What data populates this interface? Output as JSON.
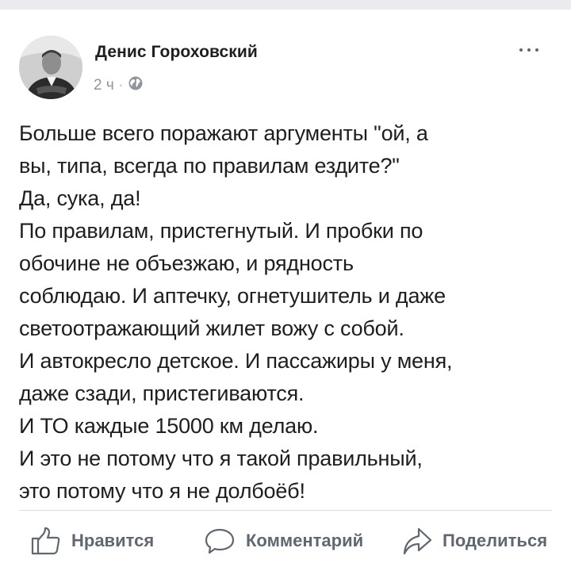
{
  "post": {
    "author_name": "Денис Гороховский",
    "time_ago": "2 ч",
    "separator": "·",
    "privacy_icon": "globe-icon",
    "text_lines": [
      "Больше всего поражают аргументы \"ой, а",
      "вы, типа, всегда по правилам ездите?\"",
      "Да, сука, да!",
      "По правилам, пристегнутый. И пробки по",
      "обочине не объезжаю, и рядность",
      "соблюдаю. И аптечку, огнетушитель и даже",
      "светоотражающий жилет вожу с собой.",
      "И автокресло детское. И пассажиры у меня,",
      "даже сзади, пристегиваются.",
      "И ТО каждые 15000 км делаю.",
      "И это не потому что я такой правильный,",
      "это потому что я не долбоёб!"
    ]
  },
  "actions": {
    "like_label": "Нравится",
    "comment_label": "Комментарий",
    "share_label": "Поделиться"
  },
  "icons": {
    "more": "more-dots-icon",
    "like": "thumbs-up-icon",
    "comment": "comment-bubble-icon",
    "share": "share-arrow-icon"
  },
  "colors": {
    "text": "#1c1e21",
    "meta": "#90949c",
    "action": "#606770",
    "divider": "#dadde1"
  }
}
